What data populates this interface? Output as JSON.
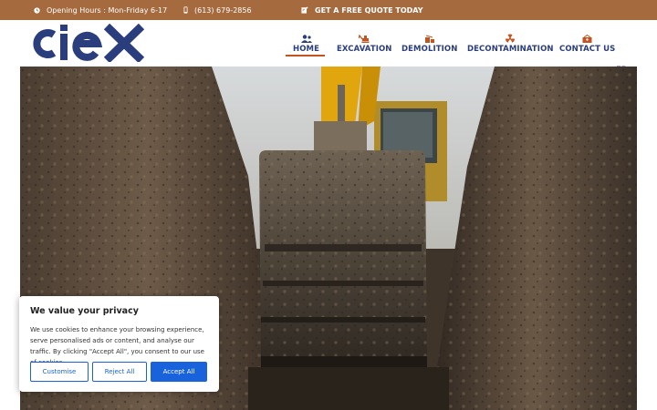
{
  "topbar": {
    "hours": "Opening Hours : Mon-Friday 6-17",
    "phone": "(613) 679-2856",
    "quote": "GET A FREE QUOTE TODAY"
  },
  "brand": {
    "logo_text": "ciex",
    "logo_color": "#2a3d7c"
  },
  "nav": {
    "items": [
      {
        "label": "HOME",
        "icon": "users-icon",
        "active": true
      },
      {
        "label": "EXCAVATION",
        "icon": "excavator-icon"
      },
      {
        "label": "DEMOLITION",
        "icon": "demolition-icon"
      },
      {
        "label": "DECONTAMINATION",
        "icon": "radiation-icon"
      },
      {
        "label": "CONTACT US",
        "icon": "contact-icon"
      }
    ],
    "language": "FR"
  },
  "hero": {
    "image": "excavator-bucket-in-trench"
  },
  "cookie": {
    "title": "We value your privacy",
    "body": "We use cookies to enhance your browsing experience, serve personalised ads or content, and analyse our traffic. By clicking \"Accept All\", you consent to our use of cookies.",
    "customise": "Customise",
    "reject": "Reject All",
    "accept": "Accept All"
  },
  "colors": {
    "topbar": "#a56a3d",
    "nav_text": "#2a3d7c",
    "nav_icon": "#c4531f",
    "cookie_button": "#1863dc"
  }
}
